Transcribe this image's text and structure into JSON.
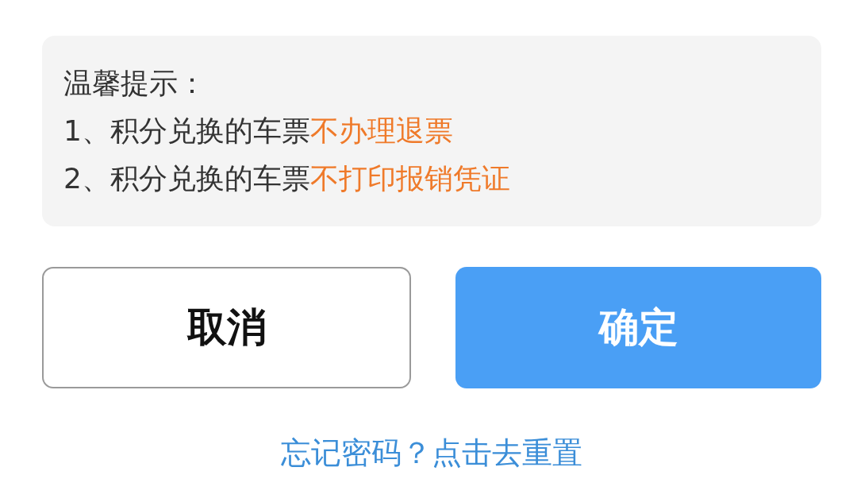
{
  "notice": {
    "title": "温馨提示：",
    "lines": [
      {
        "text": "1、积分兑换的车票",
        "highlight": "不办理退票"
      },
      {
        "text": "2、积分兑换的车票",
        "highlight": "不打印报销凭证"
      }
    ]
  },
  "buttons": [
    {
      "label": "取消",
      "kind": "secondary"
    },
    {
      "label": "确定",
      "kind": "primary"
    }
  ],
  "reset_link": "忘记密码？点击去重置"
}
